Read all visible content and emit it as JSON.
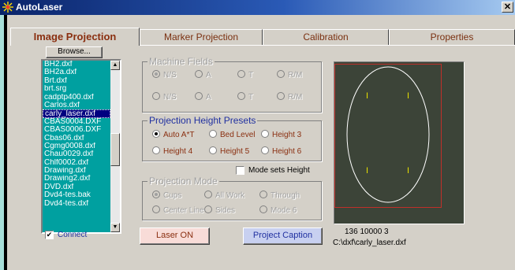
{
  "window": {
    "title": "AutoLaser",
    "close": "✕"
  },
  "tabs": [
    {
      "label": "Image Projection",
      "active": true
    },
    {
      "label": "Marker Projection",
      "active": false
    },
    {
      "label": "Calibration",
      "active": false
    },
    {
      "label": "Properties",
      "active": false
    }
  ],
  "browse_label": "Browse...",
  "files": [
    "BH2.dxf",
    "BH2a.dxf",
    "Brt.dxf",
    "brt.srg",
    "cadptp400.dxf",
    "Carlos.dxf",
    "carly_laser.dxf",
    "CBAS0004.DXF",
    "CBAS0006.DXF",
    "Cbas06.dxf",
    "Cgmg0008.dxf",
    "Chau0029.dxf",
    "Chlf0002.dxf",
    "Drawing.dxf",
    "Drawing2.dxf",
    "DVD.dxf",
    "Dvd4-tes.bak",
    "Dvd4-tes.dxf"
  ],
  "selected_file_index": 6,
  "connect": {
    "label": "Connect",
    "checked": true
  },
  "machine_fields": {
    "title": "Machine Fields",
    "row1": [
      "N/S",
      "A",
      "T",
      "R/M"
    ],
    "row2": [
      "N/S",
      "A",
      "T",
      "R/M"
    ]
  },
  "height_presets": {
    "title": "Projection Height Presets",
    "row1": [
      "Auto A*T",
      "Bed Level",
      "Height 3"
    ],
    "row2": [
      "Height 4",
      "Height 5",
      "Height 6"
    ],
    "selected": "Auto A*T"
  },
  "mode_sets_height": {
    "label": "Mode sets Height",
    "checked": false
  },
  "projection_mode": {
    "title": "Projection Mode",
    "row1": [
      "Cups",
      "All Work",
      "Through"
    ],
    "row2": [
      "Center Line",
      "Sides",
      "Mode 6"
    ],
    "selected": "Cups"
  },
  "buttons": {
    "laser_on": "Laser ON",
    "project_caption": "Project Caption"
  },
  "status": {
    "coords": "136  10000  3",
    "path": "C:\\dxf\\carly_laser.dxf"
  },
  "markers": [
    "I",
    "I",
    "I",
    "I"
  ],
  "colors": {
    "title_start": "#0a246a",
    "file_bg": "#00a0a0",
    "preview_bg": "#3c4438",
    "preview_rect": "#c0302a",
    "marker": "#e8e000"
  }
}
